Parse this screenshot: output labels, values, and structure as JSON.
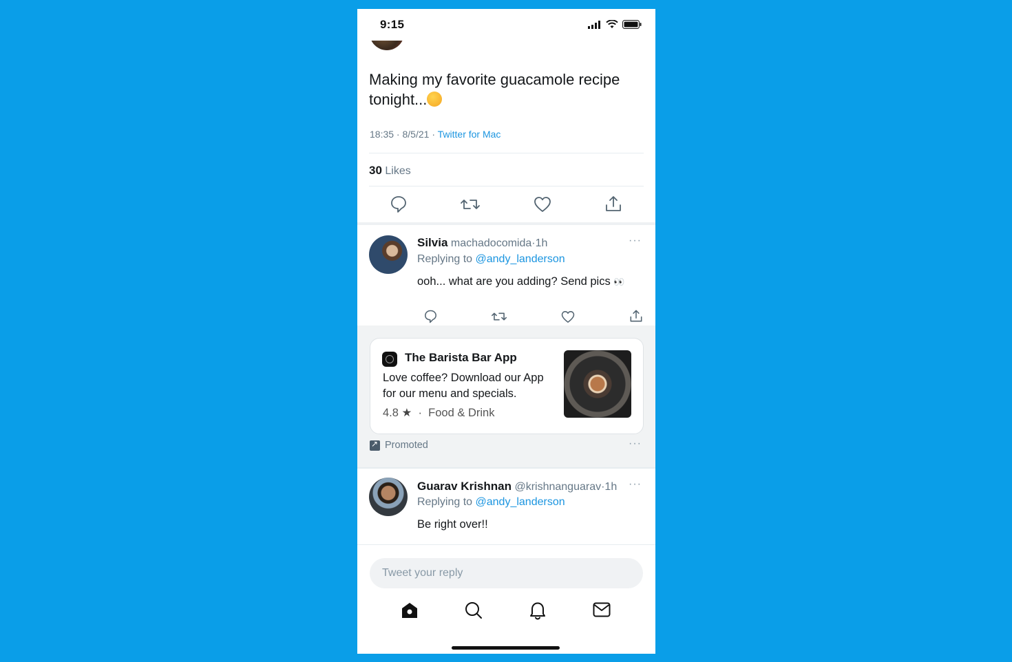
{
  "status_bar": {
    "time": "9:15"
  },
  "tweet": {
    "text": "Making my favorite guacamole recipe tonight...",
    "emoji": "😋",
    "time": "18:35",
    "date": "8/5/21",
    "source": "Twitter for Mac",
    "likes_count": "30",
    "likes_label": "Likes"
  },
  "replies": [
    {
      "name": "Silvia",
      "handle": "machadocomida",
      "age": "1h",
      "replying_prefix": "Replying to",
      "replying_to": "@andy_landerson",
      "body": "ooh... what are you adding? Send pics",
      "body_emoji": "👀"
    },
    {
      "name": "Guarav Krishnan",
      "handle": "@krishnanguarav",
      "age": "1h",
      "replying_prefix": "Replying to",
      "replying_to": "@andy_landerson",
      "body": "Be right over!!"
    }
  ],
  "promo": {
    "app_name": "The Barista Bar App",
    "description": "Love coffee? Download our App for our menu and specials.",
    "rating": "4.8",
    "star": "★",
    "category": "Food & Drink",
    "promoted_label": "Promoted"
  },
  "compose": {
    "placeholder": "Tweet your reply"
  },
  "more_glyph": "···",
  "colors": {
    "background": "#0a9ee8",
    "link": "#1b95e0",
    "muted": "#657786"
  }
}
